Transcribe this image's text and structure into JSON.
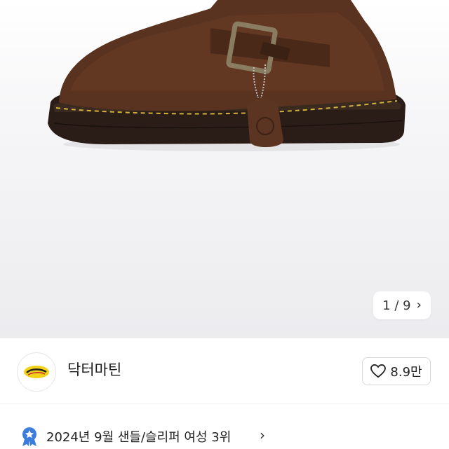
{
  "product_image": {
    "alt": ""
  },
  "pager": {
    "label": "1 / 9",
    "chevron": "›",
    "icon": "chevron-right-icon"
  },
  "brand": {
    "name": "닥터마틴",
    "logo_icon": "dr-martens-logo"
  },
  "like": {
    "count": "8.9만",
    "icon": "heart-outline-icon"
  },
  "ranking": {
    "text": "2024년 9월 샌들/슬리퍼 여성 3위",
    "chevron": "›",
    "badge_icon": "star-medal-icon",
    "badge_color": "#3b7ddd"
  }
}
